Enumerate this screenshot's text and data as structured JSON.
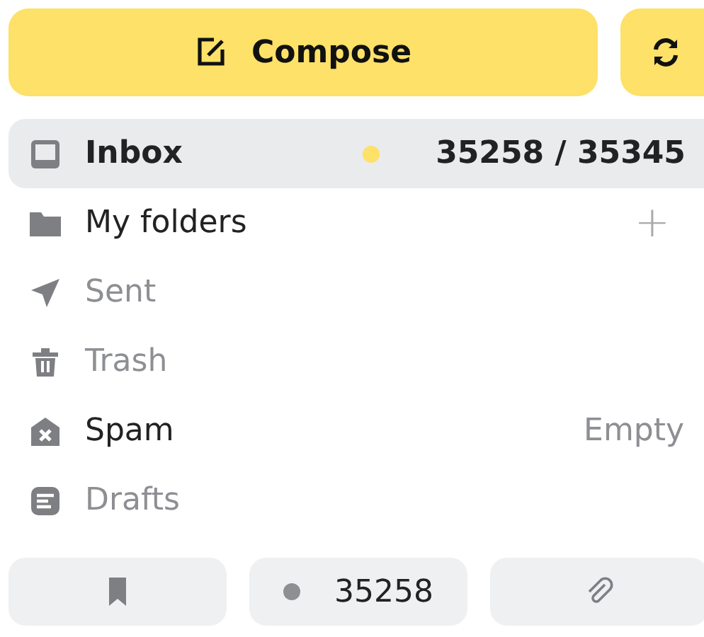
{
  "compose_button": {
    "label": "Compose"
  },
  "folders": [
    {
      "kind": "inbox",
      "label": "Inbox",
      "selected": true,
      "muted": false,
      "unread_dot": true,
      "count": "35258 / 35345"
    },
    {
      "kind": "folder",
      "label": "My folders",
      "selected": false,
      "muted": false,
      "action": "+"
    },
    {
      "kind": "sent",
      "label": "Sent",
      "selected": false,
      "muted": true
    },
    {
      "kind": "trash",
      "label": "Trash",
      "selected": false,
      "muted": true
    },
    {
      "kind": "spam",
      "label": "Spam",
      "selected": false,
      "muted": false,
      "note": "Empty"
    },
    {
      "kind": "drafts",
      "label": "Drafts",
      "selected": false,
      "muted": true
    }
  ],
  "filters": [
    {
      "kind": "bookmark"
    },
    {
      "kind": "unread",
      "count": "35258"
    },
    {
      "kind": "attachment"
    }
  ]
}
